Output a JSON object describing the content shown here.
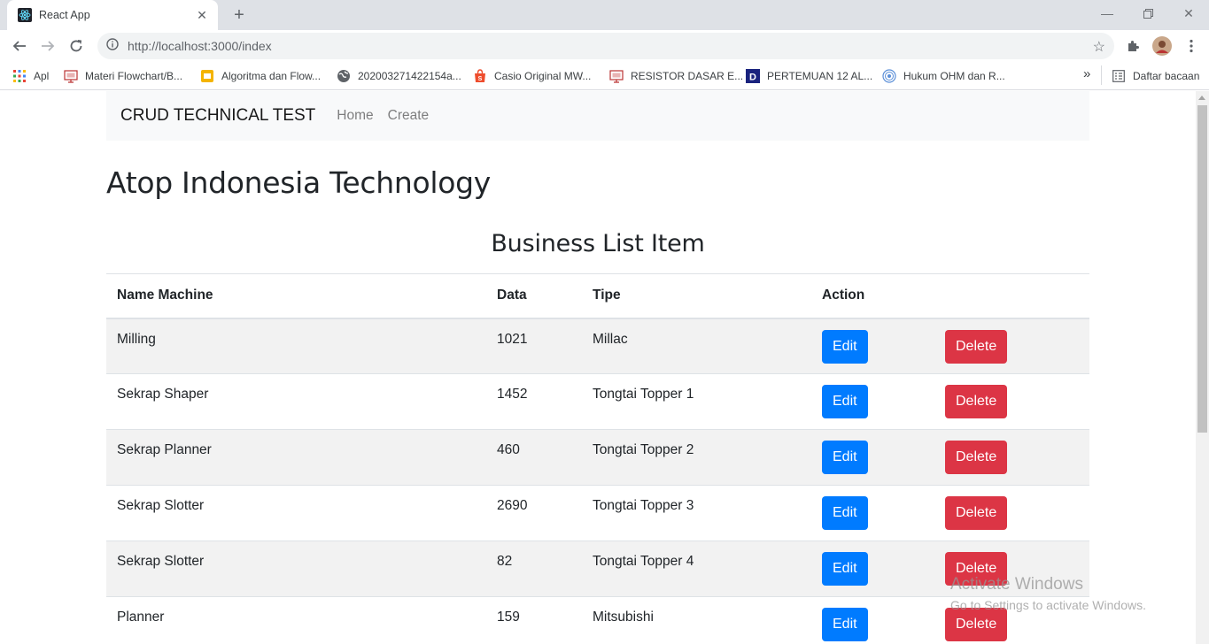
{
  "browser": {
    "tab_title": "React App",
    "url": "http://localhost:3000/index",
    "bookmarks": [
      {
        "label": "Apl",
        "icon": "apps-grid-icon"
      },
      {
        "label": "Materi Flowchart/B...",
        "icon": "slides-icon"
      },
      {
        "label": "Algoritma dan Flow...",
        "icon": "slides-yellow-icon"
      },
      {
        "label": "202003271422154a...",
        "icon": "globe-icon"
      },
      {
        "label": "Casio Original MW...",
        "icon": "shopee-icon"
      },
      {
        "label": "RESISTOR DASAR E...",
        "icon": "slides-icon"
      },
      {
        "label": "PERTEMUAN 12 AL...",
        "icon": "d-icon"
      },
      {
        "label": "Hukum OHM dan R...",
        "icon": "globe-blue-icon"
      }
    ],
    "more_bookmarks": "»",
    "reading_list": "Daftar bacaan"
  },
  "navbar": {
    "brand": "CRUD TECHNICAL TEST",
    "links": [
      "Home",
      "Create"
    ]
  },
  "page": {
    "title": "Atop Indonesia Technology",
    "section_title": "Business List Item"
  },
  "table": {
    "headers": [
      "Name Machine",
      "Data",
      "Tipe",
      "Action"
    ],
    "edit_label": "Edit",
    "delete_label": "Delete",
    "rows": [
      {
        "name": "Milling",
        "data": "1021",
        "tipe": "Millac"
      },
      {
        "name": "Sekrap Shaper",
        "data": "1452",
        "tipe": "Tongtai Topper 1"
      },
      {
        "name": "Sekrap Planner",
        "data": "460",
        "tipe": "Tongtai Topper 2"
      },
      {
        "name": "Sekrap Slotter",
        "data": "2690",
        "tipe": "Tongtai Topper 3"
      },
      {
        "name": "Sekrap Slotter",
        "data": "82",
        "tipe": "Tongtai Topper 4"
      },
      {
        "name": "Planner",
        "data": "159",
        "tipe": "Mitsubishi"
      }
    ]
  },
  "watermark": {
    "line1": "Activate Windows",
    "line2": "Go to Settings to activate Windows."
  },
  "colors": {
    "primary": "#007bff",
    "danger": "#dc3545",
    "navbar_bg": "#f8f9fa",
    "stripe_bg": "#f2f2f2"
  }
}
